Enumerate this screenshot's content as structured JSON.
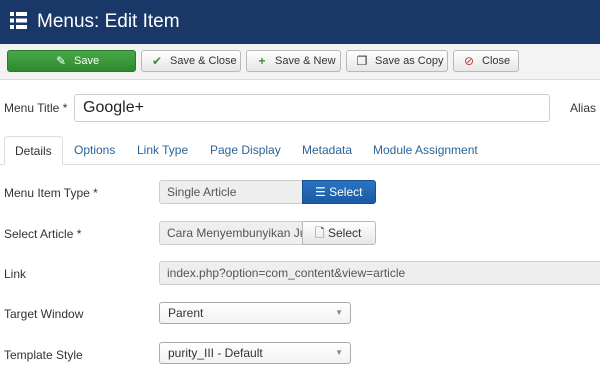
{
  "header": {
    "title": "Menus: Edit Item",
    "icon": "menu-list-icon"
  },
  "toolbar": {
    "save_label": "Save",
    "save_close_label": "Save & Close",
    "save_new_label": "Save & New",
    "save_copy_label": "Save as Copy",
    "close_label": "Close"
  },
  "form": {
    "menu_title_label": "Menu Title *",
    "menu_title_value": "Google+",
    "alias_label": "Alias"
  },
  "tabs": [
    {
      "label": "Details"
    },
    {
      "label": "Options"
    },
    {
      "label": "Link Type"
    },
    {
      "label": "Page Display"
    },
    {
      "label": "Metadata"
    },
    {
      "label": "Module Assignment"
    }
  ],
  "details": {
    "item_type_label": "Menu Item Type *",
    "item_type_value": "Single Article",
    "item_type_button": "Select",
    "article_label": "Select Article *",
    "article_value": "Cara Menyembunyikan Ju",
    "article_button": "Select",
    "link_label": "Link",
    "link_value": "index.php?option=com_content&view=article",
    "target_label": "Target Window",
    "target_value": "Parent",
    "template_label": "Template Style",
    "template_value": "purity_III - Default"
  },
  "colors": {
    "header_bg": "#1a3867",
    "save_green": "#3a9a3a",
    "select_blue": "#2268b8",
    "tab_link": "#2a6496"
  }
}
